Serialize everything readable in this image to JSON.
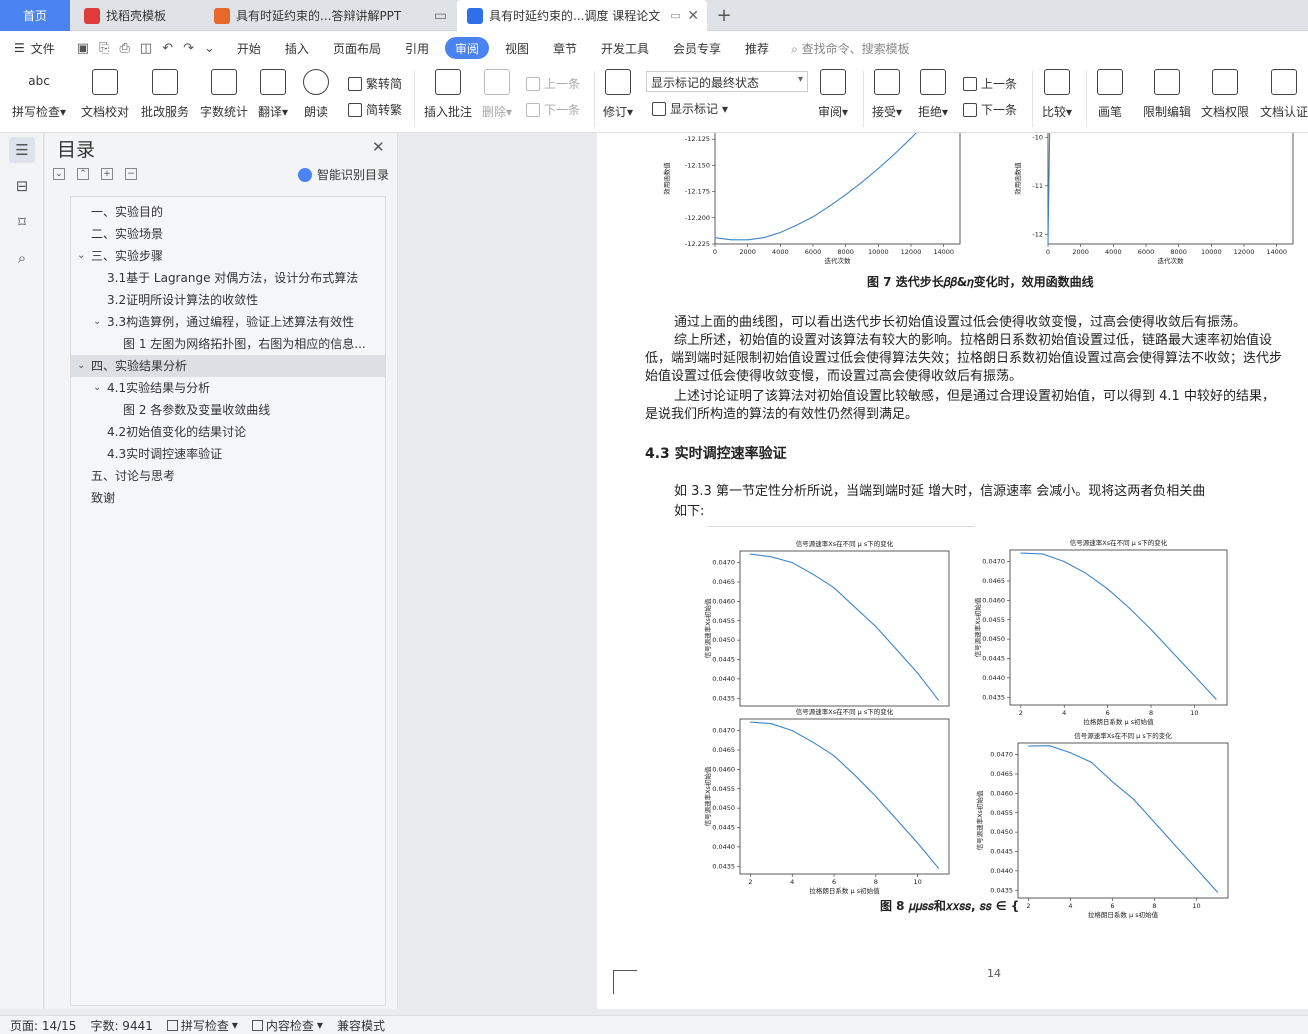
{
  "tabs": {
    "home": "首页",
    "t1": "找稻壳模板",
    "t2": "具有时延约束的...答辩讲解PPT",
    "t3": "具有时延约束的...调度 课程论文",
    "plus": "+"
  },
  "menu": {
    "file": "文件",
    "items": [
      "开始",
      "插入",
      "页面布局",
      "引用",
      "审阅",
      "视图",
      "章节",
      "开发工具",
      "会员专享",
      "推荐"
    ],
    "search": "查找命令、搜索模板"
  },
  "ribbon": {
    "spellcheck": "拼写检查",
    "proofread": "文档校对",
    "batch": "批改服务",
    "wordcount": "字数统计",
    "translate": "翻译",
    "read": "朗读",
    "trad2simp": "繁转简",
    "simp2trad": "简转繁",
    "insert_comment": "插入批注",
    "delete": "删除",
    "prev": "上一条",
    "next": "下一条",
    "revise": "修订",
    "markup_select": "显示标记的最终状态",
    "show_markup": "显示标记",
    "review": "审阅",
    "accept": "接受",
    "reject": "拒绝",
    "prev2": "上一条",
    "next2": "下一条",
    "compare": "比较",
    "pen": "画笔",
    "restrict": "限制编辑",
    "rights": "文档权限",
    "certify": "文档认证",
    "abc": "abc"
  },
  "toc": {
    "title": "目录",
    "smart": "智能识别目录",
    "items": [
      {
        "label": "一、实验目的",
        "level": 1,
        "expand": ""
      },
      {
        "label": "二、实验场景",
        "level": 1,
        "expand": ""
      },
      {
        "label": "三、实验步骤",
        "level": 1,
        "expand": "open"
      },
      {
        "label": "3.1基于 Lagrange 对偶方法，设计分布式算法",
        "level": 2,
        "expand": ""
      },
      {
        "label": "3.2证明所设计算法的收敛性",
        "level": 2,
        "expand": ""
      },
      {
        "label": "3.3构造算例，通过编程，验证上述算法有效性",
        "level": 2,
        "expand": "open"
      },
      {
        "label": "图 1  左图为网络拓扑图，右图为相应的信息...",
        "level": 3,
        "expand": ""
      },
      {
        "label": "四、实验结果分析",
        "level": 1,
        "expand": "open"
      },
      {
        "label": "4.1实验结果与分析",
        "level": 2,
        "expand": "open"
      },
      {
        "label": "图 2 各参数及变量收敛曲线",
        "level": 3,
        "expand": ""
      },
      {
        "label": "4.2初始值变化的结果讨论",
        "level": 2,
        "expand": ""
      },
      {
        "label": "4.3实时调控速率验证",
        "level": 2,
        "expand": ""
      },
      {
        "label": "五、讨论与思考",
        "level": 1,
        "expand": ""
      },
      {
        "label": "致谢",
        "level": 1,
        "expand": ""
      }
    ],
    "active_index": 7
  },
  "doc": {
    "fig7_caption": "图 7  迭代步长𝛽𝛽&𝜂变化时，效用函数曲线",
    "p1": "通过上面的曲线图，可以看出迭代步长初始值设置过低会使得收敛变慢，过高会使得收敛后有振荡。",
    "p2a": "综上所述，初始值的设置对该算法有较大的影响。拉格朗日系数初始值设置过低，链路最大速率初始值设",
    "p2b": "低，端到端时延限制初始值设置过低会使得算法失效；拉格朗日系数初始值设置过高会使得算法不收敛；迭代步",
    "p2c": "始值设置过低会使得收敛变慢，而设置过高会使得收敛后有振荡。",
    "p3a": "上述讨论证明了该算法对初始值设置比较敏感，但是通过合理设置初始值，可以得到 4.1 中较好的结果，",
    "p3b": "是说我们所构造的算法的有效性仍然得到满足。",
    "heading": "4.3 实时调控速率验证",
    "p4a": "如 3.3 第一节定性分析所说，当端到端时延        增大时，信源速率        会减小。现将这两者负相关曲",
    "p4b": "如下:",
    "fig8_caption": "图 8  𝜇𝜇𝑠𝑠和𝑥𝑥𝑠𝑠, 𝑠𝑠 ∈ {",
    "page_number": "14"
  },
  "chart_data": [
    {
      "type": "line",
      "title": "",
      "xlabel": "迭代次数",
      "ylabel": "效用函数值",
      "xlim": [
        0,
        15000
      ],
      "ylim": [
        -12.225,
        -12.1
      ],
      "xticks": [
        "0",
        "2000",
        "4000",
        "6000",
        "8000",
        "10000",
        "12000",
        "14000"
      ],
      "yticks": [
        "-12.125",
        "-12.150",
        "-12.175",
        "-12.200",
        "-12.225"
      ],
      "x": [
        0,
        1000,
        2000,
        3000,
        4000,
        5000,
        6000,
        7000,
        8000,
        9000,
        10000,
        11000,
        12000,
        13000,
        14000
      ],
      "y": [
        -12.219,
        -12.221,
        -12.221,
        -12.219,
        -12.214,
        -12.207,
        -12.199,
        -12.189,
        -12.178,
        -12.166,
        -12.153,
        -12.139,
        -12.124,
        -12.108,
        -12.091
      ]
    },
    {
      "type": "line",
      "title": "",
      "xlabel": "迭代次数",
      "ylabel": "效用函数值",
      "xlim": [
        0,
        15000
      ],
      "ylim": [
        -12.2,
        -9.5
      ],
      "xticks": [
        "0",
        "2000",
        "4000",
        "6000",
        "8000",
        "10000",
        "12000",
        "14000"
      ],
      "yticks": [
        "-10",
        "-11",
        "-12"
      ],
      "x": [
        0,
        30,
        60,
        90,
        120
      ],
      "y": [
        -12.2,
        -11.5,
        -10.8,
        -10.1,
        -9.5
      ]
    },
    {
      "type": "line",
      "title": "信号源速率Xs在不同 μ s下的变化",
      "xlabel": "",
      "ylabel": "信号源速率Xs初始值",
      "xlim": [
        1.5,
        11.5
      ],
      "ylim": [
        0.0433,
        0.0473
      ],
      "yticks": [
        "0.0470",
        "0.0465",
        "0.0460",
        "0.0455",
        "0.0450",
        "0.0445",
        "0.0440",
        "0.0435"
      ],
      "x": [
        2,
        3,
        4,
        5,
        6,
        7,
        8,
        9,
        10,
        11
      ],
      "y": [
        0.04722,
        0.04715,
        0.047,
        0.0467,
        0.04635,
        0.04585,
        0.04535,
        0.04475,
        0.04415,
        0.04345
      ]
    },
    {
      "type": "line",
      "title": "信号源速率Xs在不同 μ s下的变化",
      "xlabel": "拉格朗日系数 μ s初始值",
      "ylabel": "信号源速率Xs初始值",
      "xlim": [
        1.5,
        11.5
      ],
      "xticks": [
        "2",
        "4",
        "6",
        "8",
        "10"
      ],
      "ylim": [
        0.0433,
        0.0473
      ],
      "yticks": [
        "0.0470",
        "0.0465",
        "0.0460",
        "0.0455",
        "0.0450",
        "0.0445",
        "0.0440",
        "0.0435"
      ],
      "x": [
        2,
        3,
        4,
        5,
        6,
        7,
        8,
        9,
        10,
        11
      ],
      "y": [
        0.04722,
        0.04718,
        0.047,
        0.0467,
        0.04635,
        0.04585,
        0.0453,
        0.0447,
        0.0441,
        0.04345
      ]
    },
    {
      "type": "line",
      "title": "信号源速率Xs在不同 μ s下的变化",
      "xlabel": "拉格朗日系数 μ s初始值",
      "ylabel": "信号源速率Xs初始值",
      "xlim": [
        1.5,
        11.5
      ],
      "xticks": [
        "2",
        "4",
        "6",
        "8",
        "10"
      ],
      "ylim": [
        0.0433,
        0.0473
      ],
      "yticks": [
        "0.0470",
        "0.0465",
        "0.0460",
        "0.0455",
        "0.0450",
        "0.0445",
        "0.0440",
        "0.0435"
      ],
      "x": [
        2,
        3,
        4,
        5,
        6,
        7,
        8,
        9,
        10,
        11
      ],
      "y": [
        0.04722,
        0.0472,
        0.047,
        0.0467,
        0.0463,
        0.0458,
        0.04525,
        0.04465,
        0.04405,
        0.04345
      ]
    },
    {
      "type": "line",
      "title": "信号源速率Xs在不同 μ s下的变化",
      "xlabel": "拉格朗日系数 μ s初始值",
      "ylabel": "信号源速率Xs初始值",
      "xlim": [
        1.5,
        11.5
      ],
      "xticks": [
        "2",
        "4",
        "6",
        "8",
        "10"
      ],
      "ylim": [
        0.0433,
        0.0473
      ],
      "yticks": [
        "0.0470",
        "0.0465",
        "0.0460",
        "0.0455",
        "0.0450",
        "0.0445",
        "0.0440",
        "0.0435"
      ],
      "x": [
        2,
        3,
        4,
        5,
        6,
        7,
        8,
        9,
        10,
        11
      ],
      "y": [
        0.04722,
        0.04723,
        0.04705,
        0.0468,
        0.0463,
        0.04585,
        0.04525,
        0.04465,
        0.04405,
        0.04345
      ]
    }
  ],
  "status": {
    "page": "页面: 14/15",
    "words": "字数: 9441",
    "spell": "拼写检查",
    "content": "内容检查",
    "compat": "兼容模式"
  },
  "colors": {
    "accent": "#4b83f0",
    "line": "#3a86c8"
  }
}
